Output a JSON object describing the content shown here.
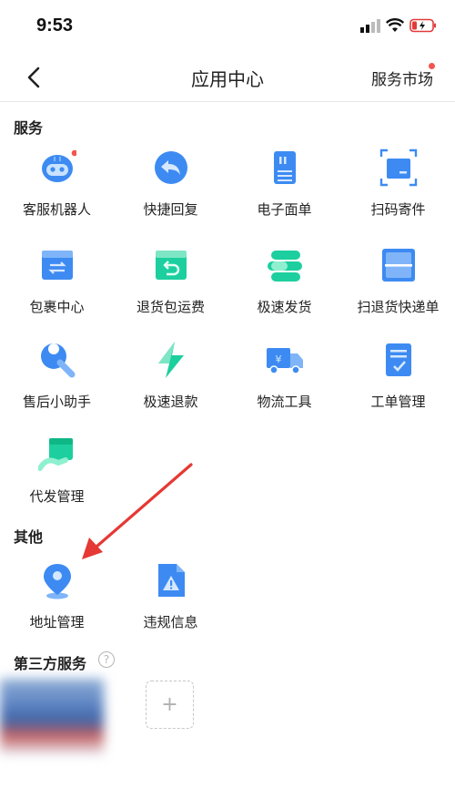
{
  "status_bar": {
    "time": "9:53"
  },
  "nav": {
    "title": "应用中心",
    "right_label": "服务市场"
  },
  "sections": {
    "services": {
      "title": "服务",
      "items": [
        {
          "label": "客服机器人",
          "icon": "robot-icon"
        },
        {
          "label": "快捷回复",
          "icon": "reply-icon"
        },
        {
          "label": "电子面单",
          "icon": "waybill-icon"
        },
        {
          "label": "扫码寄件",
          "icon": "scan-box-icon"
        },
        {
          "label": "包裹中心",
          "icon": "package-icon"
        },
        {
          "label": "退货包运费",
          "icon": "return-box-icon"
        },
        {
          "label": "极速发货",
          "icon": "fast-ship-icon"
        },
        {
          "label": "扫退货快递单",
          "icon": "scan-return-icon"
        },
        {
          "label": "售后小助手",
          "icon": "wrench-icon"
        },
        {
          "label": "极速退款",
          "icon": "lightning-icon"
        },
        {
          "label": "物流工具",
          "icon": "truck-icon"
        },
        {
          "label": "工单管理",
          "icon": "work-order-icon"
        },
        {
          "label": "代发管理",
          "icon": "proxy-ship-icon"
        }
      ]
    },
    "other": {
      "title": "其他",
      "items": [
        {
          "label": "地址管理",
          "icon": "location-icon"
        },
        {
          "label": "违规信息",
          "icon": "warning-doc-icon"
        }
      ]
    },
    "third_party": {
      "title": "第三方服务",
      "add_label": "+"
    }
  },
  "colors": {
    "blue": "#3d8bf2",
    "green": "#1dcf9f",
    "arrow": "#e53935",
    "badge": "#f2564f"
  }
}
